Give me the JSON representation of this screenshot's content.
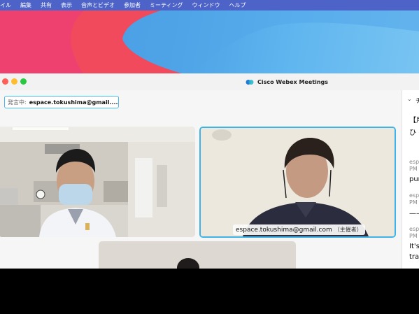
{
  "menubar": {
    "items": [
      "イル",
      "編集",
      "共有",
      "表示",
      "音声とビデオ",
      "参加者",
      "ミーティング",
      "ウィンドウ",
      "ヘルプ"
    ]
  },
  "window": {
    "title": "Cisco Webex Meetings"
  },
  "speaking": {
    "label": "発言中:",
    "value": "espace.tokushima@gmail...."
  },
  "videos": {
    "host_label": "espace.tokushima@gmail.com",
    "host_role": "（主催者）"
  },
  "chat_panel": {
    "header_fragment": "チ",
    "line_1": "【用",
    "line_2": "ひ",
    "msg1_meta_1": "esp",
    "msg1_meta_2": "PM",
    "msg1_text": "pur",
    "msg2_meta_1": "esp",
    "msg2_meta_2": "PM",
    "msg2_text": "——",
    "msg3_meta_1": "esp",
    "msg3_meta_2": "PM",
    "msg3_text_1": "It's",
    "msg3_text_2": "trai"
  },
  "colors": {
    "menubar": "#4e63c8",
    "accent": "#3cb4ea"
  }
}
